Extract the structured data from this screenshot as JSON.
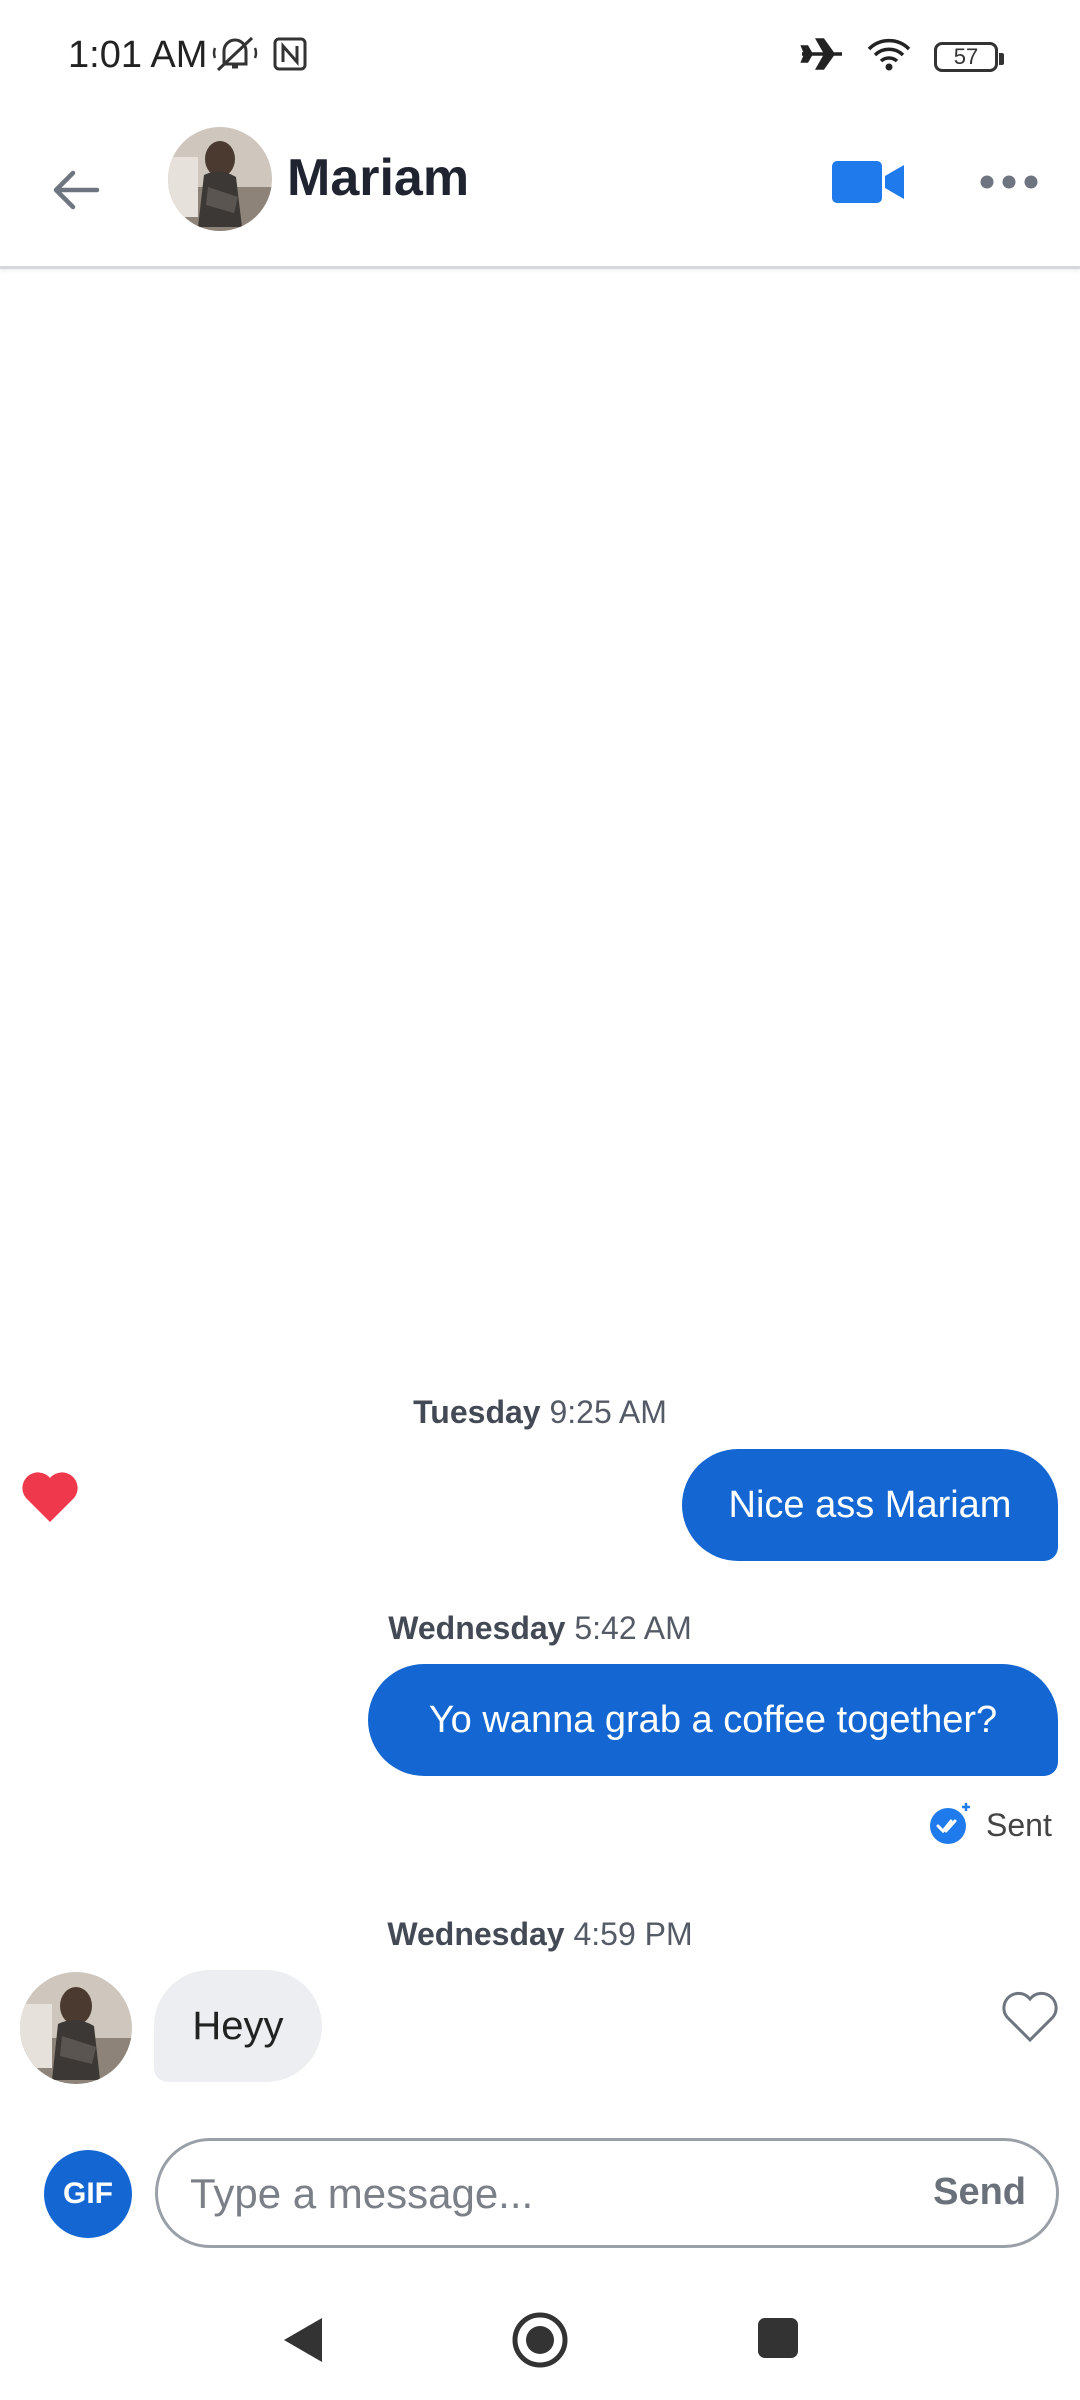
{
  "status_bar": {
    "time": "1:01 AM",
    "battery": "57",
    "icons": [
      "mute-vibrate-icon",
      "nfc-icon",
      "airplane-icon",
      "wifi-icon",
      "battery-icon"
    ]
  },
  "header": {
    "contact_name": "Mariam",
    "icons": [
      "back-arrow-icon",
      "video-call-icon",
      "more-options-icon"
    ],
    "accent_color": "#1F7AEC"
  },
  "messages": [
    {
      "type": "timestamp",
      "day": "Tuesday",
      "time": "9:25 AM"
    },
    {
      "type": "outgoing",
      "text": "Nice ass Mariam",
      "liked": true
    },
    {
      "type": "timestamp",
      "day": "Wednesday",
      "time": "5:42 AM"
    },
    {
      "type": "outgoing",
      "text": "Yo wanna grab a coffee together?",
      "status": "Sent"
    },
    {
      "type": "timestamp",
      "day": "Wednesday",
      "time": "4:59 PM"
    },
    {
      "type": "incoming",
      "text": "Heyy",
      "liked": false
    }
  ],
  "composer": {
    "gif_label": "GIF",
    "placeholder": "Type a message...",
    "value": "",
    "send_label": "Send"
  },
  "colors": {
    "bubble_outgoing": "#1467D3",
    "bubble_incoming": "#ECEEF1",
    "heart_liked": "#F0384C"
  }
}
